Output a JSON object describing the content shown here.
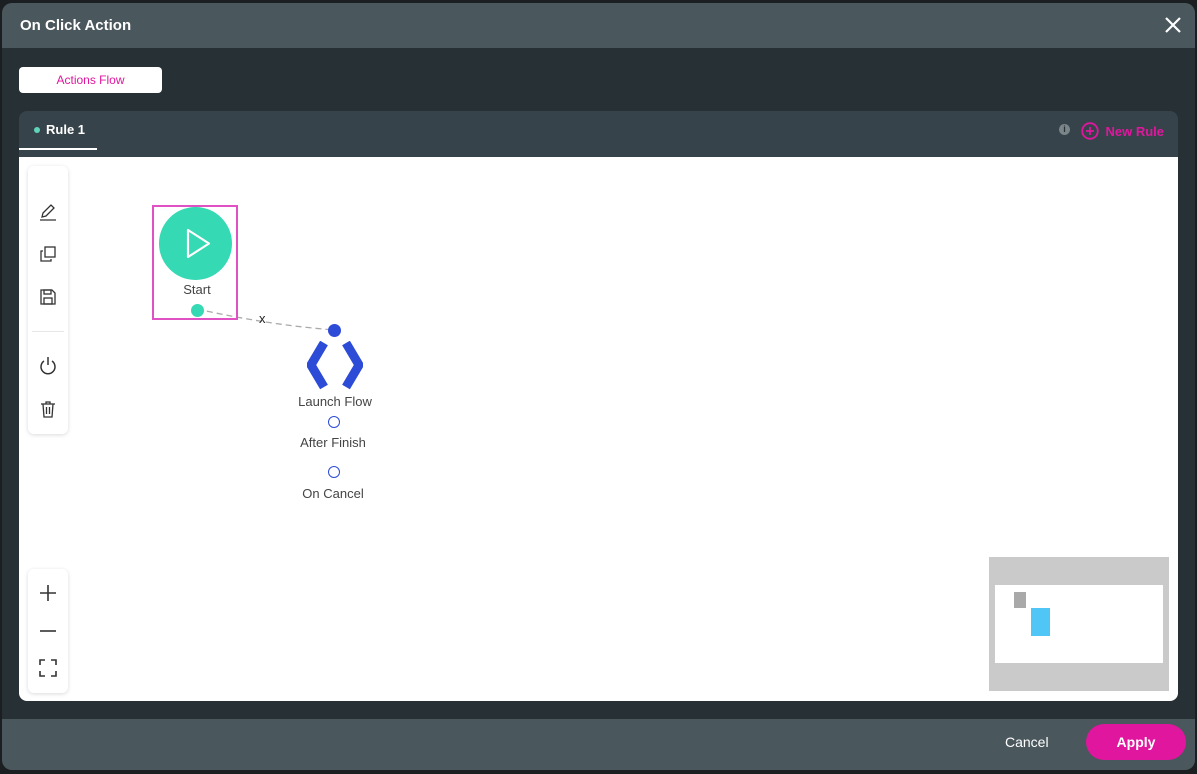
{
  "dialog": {
    "title": "On Click Action",
    "close_icon": "close-icon"
  },
  "tabs": {
    "actions_flow": "Actions Flow"
  },
  "rules": {
    "items": [
      {
        "label": "Rule 1",
        "active": true
      }
    ],
    "info": "i",
    "new_rule": "New Rule"
  },
  "toolbar": {
    "tools": [
      "edit-icon",
      "duplicate-icon",
      "save-icon",
      "power-icon",
      "delete-icon"
    ],
    "zoom": [
      "zoom-in-icon",
      "zoom-out-icon",
      "fit-screen-icon"
    ]
  },
  "flow": {
    "start": {
      "label": "Start"
    },
    "connector_delete": "x",
    "launch_flow": {
      "label": "Launch Flow",
      "outputs": [
        "After Finish",
        "On Cancel"
      ]
    }
  },
  "footer": {
    "cancel": "Cancel",
    "apply": "Apply"
  },
  "colors": {
    "accent": "#e0169e",
    "start": "#35d9b3",
    "launch": "#2c4bd6"
  }
}
